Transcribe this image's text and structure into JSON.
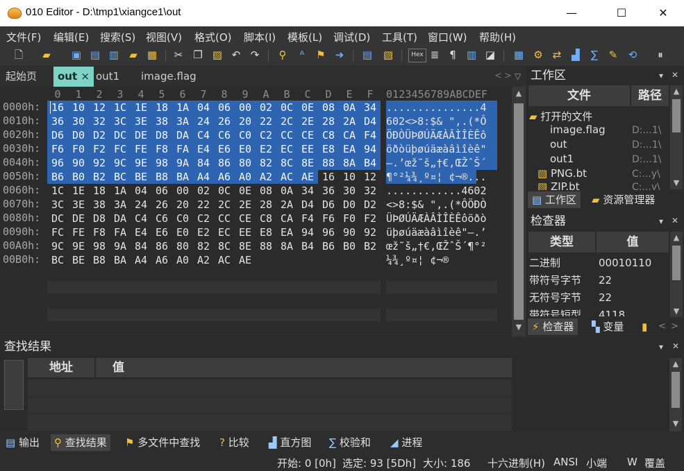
{
  "window": {
    "title": "010 Editor - D:\\tmp1\\xiangce1\\out",
    "minimize": "—",
    "maximize": "☐",
    "close": "✕"
  },
  "menu": [
    "文件(F)",
    "编辑(E)",
    "搜索(S)",
    "视图(V)",
    "格式(O)",
    "脚本(I)",
    "模板(L)",
    "调试(D)",
    "工具(T)",
    "窗口(W)",
    "帮助(H)"
  ],
  "toolbar_icons": [
    "new-file-icon",
    "open-folder-icon",
    "save-icon",
    "save-as-icon",
    "save-all-icon",
    "open-dir-icon",
    "copy-files-icon",
    "cut-icon",
    "copy-icon",
    "paste-icon",
    "undo-icon",
    "redo-icon",
    "find-icon",
    "replace-icon",
    "find-in-files-icon",
    "goto-icon",
    "template-icon",
    "script-icon",
    "hex-icon",
    "column-icon",
    "paragraph-icon",
    "columns-icon",
    "highlight-icon",
    "calculator-icon",
    "search-replace-icon",
    "compare-icon",
    "histogram-icon",
    "checksum-icon",
    "tools-icon",
    "convert-icon",
    "pause-icon"
  ],
  "toolbar_hex_label": "Hex",
  "tabs": {
    "start": "起始页",
    "active": "out",
    "active_close": "×",
    "other1": "out1",
    "other2": "image.flag"
  },
  "editor": {
    "ruler_hex": [
      "0",
      "1",
      "2",
      "3",
      "4",
      "5",
      "6",
      "7",
      "8",
      "9",
      "A",
      "B",
      "C",
      "D",
      "E",
      "F"
    ],
    "ruler_ascii": "0123456789ABCDEF",
    "rows": [
      {
        "addr": "0000h:",
        "bytes": [
          "16",
          "10",
          "12",
          "1C",
          "1E",
          "18",
          "1A",
          "04",
          "06",
          "00",
          "02",
          "0C",
          "0E",
          "08",
          "0A",
          "34"
        ],
        "ascii": "...............4"
      },
      {
        "addr": "0010h:",
        "bytes": [
          "36",
          "30",
          "32",
          "3C",
          "3E",
          "38",
          "3A",
          "24",
          "26",
          "20",
          "22",
          "2C",
          "2E",
          "28",
          "2A",
          "D4"
        ],
        "ascii": "602<>8:$& \",.(*Ô"
      },
      {
        "addr": "0020h:",
        "bytes": [
          "D6",
          "D0",
          "D2",
          "DC",
          "DE",
          "D8",
          "DA",
          "C4",
          "C6",
          "C0",
          "C2",
          "CC",
          "CE",
          "C8",
          "CA",
          "F4"
        ],
        "ascii": "ÖÐÒÜÞØÚÄÆÀÂÌÎÈÊô"
      },
      {
        "addr": "0030h:",
        "bytes": [
          "F6",
          "F0",
          "F2",
          "FC",
          "FE",
          "F8",
          "FA",
          "E4",
          "E6",
          "E0",
          "E2",
          "EC",
          "EE",
          "E8",
          "EA",
          "94"
        ],
        "ascii": "öðòüþøúäæàâìîèê\""
      },
      {
        "addr": "0040h:",
        "bytes": [
          "96",
          "90",
          "92",
          "9C",
          "9E",
          "98",
          "9A",
          "84",
          "86",
          "80",
          "82",
          "8C",
          "8E",
          "88",
          "8A",
          "B4"
        ],
        "ascii": "–.’œž˜š„†€‚ŒŽˆŠ´"
      },
      {
        "addr": "0050h:",
        "bytes": [
          "B6",
          "B0",
          "B2",
          "BC",
          "BE",
          "B8",
          "BA",
          "A4",
          "A6",
          "A0",
          "A2",
          "AC",
          "AE",
          "16",
          "10",
          "12"
        ],
        "ascii": "¶°²¼¾¸º¤¦ ¢¬®..."
      },
      {
        "addr": "0060h:",
        "bytes": [
          "1C",
          "1E",
          "18",
          "1A",
          "04",
          "06",
          "00",
          "02",
          "0C",
          "0E",
          "08",
          "0A",
          "34",
          "36",
          "30",
          "32"
        ],
        "ascii": "............4602"
      },
      {
        "addr": "0070h:",
        "bytes": [
          "3C",
          "3E",
          "38",
          "3A",
          "24",
          "26",
          "20",
          "22",
          "2C",
          "2E",
          "28",
          "2A",
          "D4",
          "D6",
          "D0",
          "D2"
        ],
        "ascii": "<>8:$& \",.(*ÔÖÐÒ"
      },
      {
        "addr": "0080h:",
        "bytes": [
          "DC",
          "DE",
          "D8",
          "DA",
          "C4",
          "C6",
          "C0",
          "C2",
          "CC",
          "CE",
          "C8",
          "CA",
          "F4",
          "F6",
          "F0",
          "F2"
        ],
        "ascii": "ÜÞØÚÄÆÀÂÌÎÈÊôöðò"
      },
      {
        "addr": "0090h:",
        "bytes": [
          "FC",
          "FE",
          "F8",
          "FA",
          "E4",
          "E6",
          "E0",
          "E2",
          "EC",
          "EE",
          "E8",
          "EA",
          "94",
          "96",
          "90",
          "92"
        ],
        "ascii": "üþøúäæàâìîèê\"–.’"
      },
      {
        "addr": "00A0h:",
        "bytes": [
          "9C",
          "9E",
          "98",
          "9A",
          "84",
          "86",
          "80",
          "82",
          "8C",
          "8E",
          "88",
          "8A",
          "B4",
          "B6",
          "B0",
          "B2"
        ],
        "ascii": "œž˜š„†€‚ŒŽˆŠ´¶°²"
      },
      {
        "addr": "00B0h:",
        "bytes": [
          "BC",
          "BE",
          "B8",
          "BA",
          "A4",
          "A6",
          "A0",
          "A2",
          "AC",
          "AE"
        ],
        "ascii": "¼¾¸º¤¦ ¢¬®"
      }
    ],
    "selected_count": 93
  },
  "workspace": {
    "title": "工作区",
    "col_file": "文件",
    "col_path": "路径",
    "open_files": "打开的文件",
    "items": [
      {
        "name": "image.flag",
        "path": "D:...1\\"
      },
      {
        "name": "out",
        "path": "D:...1\\"
      },
      {
        "name": "out1",
        "path": "D:...1\\"
      },
      {
        "name": "PNG.bt",
        "path": "C:...y\\"
      },
      {
        "name": "ZIP.bt",
        "path": "C:...y\\"
      }
    ],
    "tab_workspace": "工作区",
    "tab_explorer": "资源管理器"
  },
  "inspector": {
    "title": "检查器",
    "col_type": "类型",
    "col_value": "值",
    "rows": [
      {
        "k": "二进制",
        "v": "00010110"
      },
      {
        "k": "带符号字节",
        "v": "22"
      },
      {
        "k": "无符号字节",
        "v": "22"
      },
      {
        "k": "带符号短型",
        "v": "4118"
      }
    ],
    "tab_inspector": "检查器",
    "tab_vars": "变量"
  },
  "find": {
    "title": "查找结果",
    "col_addr": "地址",
    "col_value": "值"
  },
  "bottom_tabs": [
    "输出",
    "查找结果",
    "多文件中查找",
    "比较",
    "直方图",
    "校验和",
    "进程"
  ],
  "status": {
    "start": "开始: 0 [0h]",
    "selected": "选定: 93 [5Dh]",
    "size": "大小: 186",
    "mode": "十六进制(H)",
    "encoding": "ANSI",
    "endian": "小端",
    "w": "W",
    "overwrite": "覆盖"
  },
  "colors": {
    "selection": "#2e64b0",
    "active_tab": "#7fd2c6",
    "background": "#2b2b2b"
  }
}
